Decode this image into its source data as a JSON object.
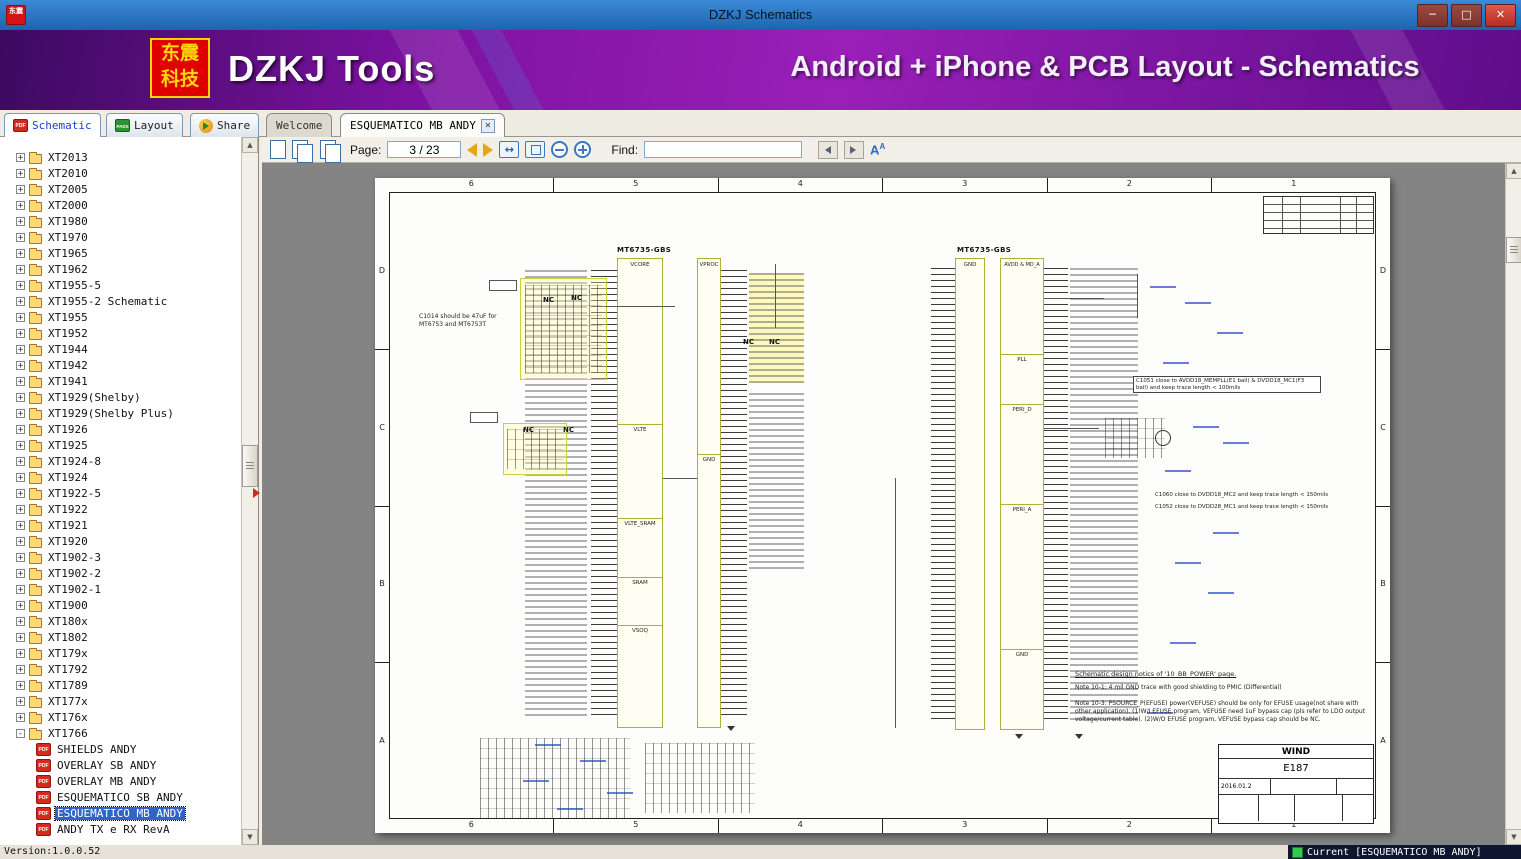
{
  "window": {
    "title": "DZKJ Schematics",
    "controls": {
      "minimize": "─",
      "maximize": "□",
      "close": "✕"
    }
  },
  "icons": {
    "pdf": "PDF",
    "pads": "PADS",
    "expand_collapsed": "+",
    "expand_expanded": "-",
    "scroll_up": "▲",
    "scroll_down": "▼",
    "fit_width": "↔",
    "font_size_a": "A"
  },
  "banner": {
    "logo_line1": "东震",
    "logo_line2": "科技",
    "app_name": "DZKJ Tools",
    "subtitle": "Android + iPhone & PCB Layout - Schematics"
  },
  "tabs": {
    "main": [
      {
        "label": "Schematic",
        "active": true
      },
      {
        "label": "Layout",
        "active": false
      },
      {
        "label": "Share",
        "active": false
      }
    ],
    "docs": [
      {
        "label": "Welcome",
        "active": false
      },
      {
        "label": "ESQUEMATICO MB ANDY",
        "active": true
      }
    ]
  },
  "sidebar": {
    "folders": [
      "XT2013",
      "XT2010",
      "XT2005",
      "XT2000",
      "XT1980",
      "XT1970",
      "XT1965",
      "XT1962",
      "XT1955-5",
      "XT1955-2 Schematic",
      "XT1955",
      "XT1952",
      "XT1944",
      "XT1942",
      "XT1941",
      "XT1929(Shelby)",
      "XT1929(Shelby Plus)",
      "XT1926",
      "XT1925",
      "XT1924-8",
      "XT1924",
      "XT1922-5",
      "XT1922",
      "XT1921",
      "XT1920",
      "XT1902-3",
      "XT1902-2",
      "XT1902-1",
      "XT1900",
      "XT180x",
      "XT1802",
      "XT179x",
      "XT1792",
      "XT1789",
      "XT177x",
      "XT176x"
    ],
    "expanded_folder": "XT1766",
    "documents": [
      {
        "label": "SHIELDS ANDY",
        "selected": false
      },
      {
        "label": "OVERLAY SB ANDY",
        "selected": false
      },
      {
        "label": "OVERLAY MB ANDY",
        "selected": false
      },
      {
        "label": "ESQUEMATICO SB ANDY",
        "selected": false
      },
      {
        "label": "ESQUEMATICO MB ANDY",
        "selected": true
      },
      {
        "label": "ANDY TX e RX RevA",
        "selected": false
      }
    ]
  },
  "toolbar": {
    "page_label": "Page:",
    "page_value": "3 / 23",
    "find_label": "Find:",
    "find_value": ""
  },
  "schematic": {
    "grid_columns": [
      "6",
      "5",
      "4",
      "3",
      "2",
      "1"
    ],
    "grid_rows": [
      "D",
      "C",
      "B",
      "A"
    ],
    "chip_left": {
      "name": "MT6735-GBS",
      "regions": [
        "VCORE",
        "VLTE",
        "VLTE_SRAM",
        "SRAM",
        "VSOQ"
      ],
      "regions_right": [
        "VPROC",
        "GND"
      ]
    },
    "chip_right": {
      "name": "MT6735-GBS",
      "regions_left": [
        "GND"
      ],
      "regions": [
        "AVDD & MD_A",
        "PLL",
        "PERI_D",
        "PERI_A",
        "GND"
      ]
    },
    "nc_label": "NC",
    "notes": {
      "cap_note": "C1014 should be 47uF for MT6753 and MT6753T",
      "c1051": "C1051 close to AVDD18_MEMPLL(E1 ball) & DVDD18_MC1(F3 ball) and keep trace length < 100mils",
      "c1060": "C1060 close to DVDD18_MC2 and keep trace length < 150mils",
      "c1052": "C1052 close to DVDD28_MC1 and keep trace length < 150mils",
      "design_title": "Schematic design notics of '10_BB_POWER' page.",
      "note_10_1": "Note 10-1: 4 mil GND trace with good shielding to PMIC (Differential)",
      "note_10_3": "Note 10-3: PSOURCE_P(EFUSE) power(VEFUSE) should be only for EFUSE usage(not share with other application). (1)W/I EFUSE program, VEFUSE need 1uF bypass cap (pls refer to LDO output voltage/current table). (2)W/O EFUSE program, VEFUSE bypass cap should be NC."
    },
    "title_block": {
      "company": "WIND",
      "code": "E187",
      "date": "2016.01.2"
    }
  },
  "statusbar": {
    "version": "Version:1.0.0.52",
    "current": "Current [ESQUEMATICO MB ANDY]"
  }
}
